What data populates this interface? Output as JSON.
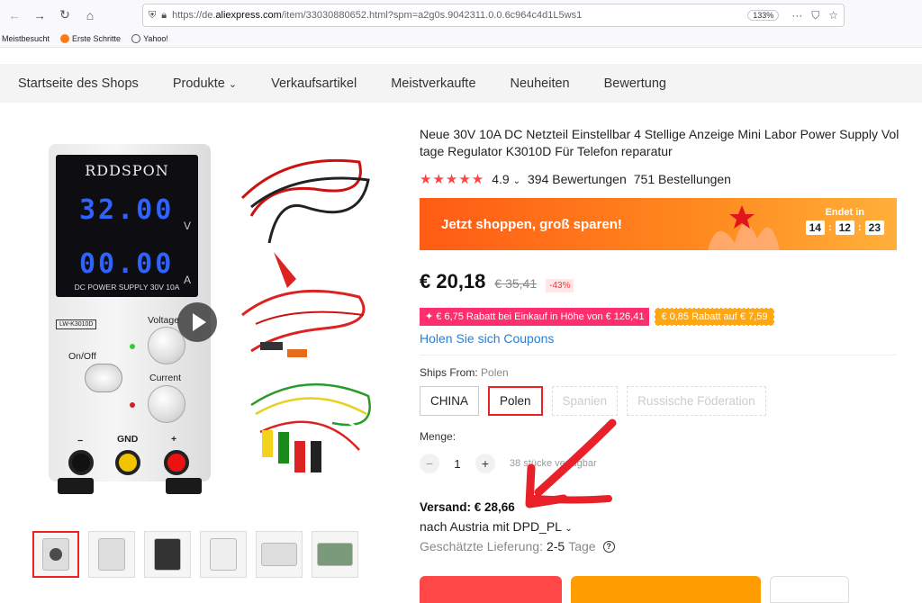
{
  "browser": {
    "url_prefix": "https://de.",
    "url_domain": "aliexpress.com",
    "url_rest": "/item/33030880652.html?spm=a2g0s.9042311.0.0.6c964c4d1L5ws1",
    "zoom": "133%",
    "bookmarks": [
      "Meistbesucht",
      "Erste Schritte",
      "Yahoo!"
    ]
  },
  "shop_nav": {
    "items": [
      "Startseite des Shops",
      "Produkte",
      "Verkaufsartikel",
      "Meistverkaufte",
      "Neuheiten",
      "Bewertung"
    ]
  },
  "product_image": {
    "brand": "RDDSPON",
    "volt_reading": "32.00",
    "amp_reading": "00.00",
    "volt_unit": "V",
    "amp_unit": "A",
    "panel_label": "DC POWER SUPPLY 30V 10A",
    "model_tag": "LW-K3010D",
    "voltage_label": "Voltage",
    "current_label": "Current",
    "onoff_label": "On/Off",
    "gnd_label": "GND",
    "minus_label": "−",
    "plus_label": "+"
  },
  "product": {
    "title": "Neue 30V 10A DC Netzteil Einstellbar 4 Stellige Anzeige Mini Labor Power Supply Voltage Regulator K3010D Für Telefon reparatur",
    "rating": "4.9",
    "reviews": "394 Bewertungen",
    "orders": "751 Bestellungen",
    "promo_text": "Jetzt shoppen, groß sparen!",
    "promo_ends_label": "Endet in",
    "timer_h": "14",
    "timer_m": "12",
    "timer_s": "23",
    "price": "€ 20,18",
    "old_price": "€ 35,41",
    "discount": "-43%",
    "coupon1": "✦ € 6,75 Rabatt bei Einkauf in Höhe von € 126,41",
    "coupon2": "€ 0,85 Rabatt auf € 7,59",
    "coupon_link": "Holen Sie sich Coupons",
    "ships_from_label": "Ships From:",
    "ships_from_selected": "Polen",
    "ship_options": [
      "CHINA",
      "Polen",
      "Spanien",
      "Russische Föderation"
    ],
    "qty_label": "Menge:",
    "qty_value": "1",
    "stock_text": "38 stücke verfügbar",
    "shipping_cost": "Versand: € 28,66",
    "ship_dest": "nach Austria mit DPD_PL",
    "delivery_label": "Geschätzte Lieferung:",
    "delivery_days": "2-5",
    "delivery_unit": "Tage"
  },
  "colors": {
    "accent_red": "#ff4747",
    "promo_orange": "#ff6a1a",
    "link_blue": "#2a7fd4",
    "annotation_arrow": "#e8202a"
  }
}
